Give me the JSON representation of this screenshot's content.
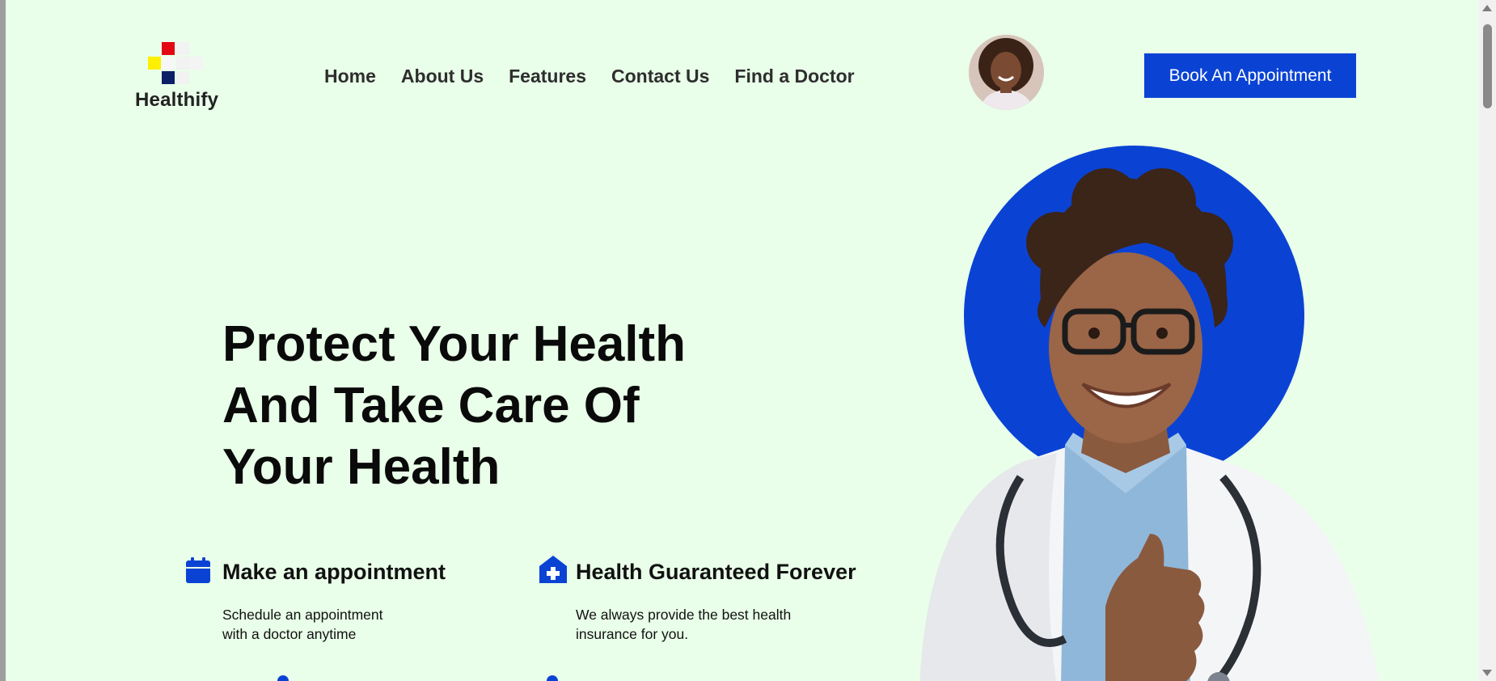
{
  "brand": {
    "name": "Healthify"
  },
  "nav": {
    "items": [
      {
        "label": "Home"
      },
      {
        "label": "About Us"
      },
      {
        "label": "Features"
      },
      {
        "label": "Contact Us"
      },
      {
        "label": "Find a Doctor"
      }
    ],
    "cta_label": "Book An Appointment"
  },
  "hero": {
    "title_line1": "Protect Your Health",
    "title_line2": "And Take Care Of",
    "title_line3": "Your Health"
  },
  "features": [
    {
      "icon": "calendar-icon",
      "title": "Make an appointment",
      "desc_line1": "Schedule an appointment",
      "desc_line2": "with a doctor anytime"
    },
    {
      "icon": "medical-house-icon",
      "title": "Health Guaranteed Forever",
      "desc_line1": "We always provide the best health",
      "desc_line2": "insurance for you."
    }
  ],
  "colors": {
    "background": "#e9ffe9",
    "accent": "#0a43d4",
    "text": "#0a0a0a"
  }
}
